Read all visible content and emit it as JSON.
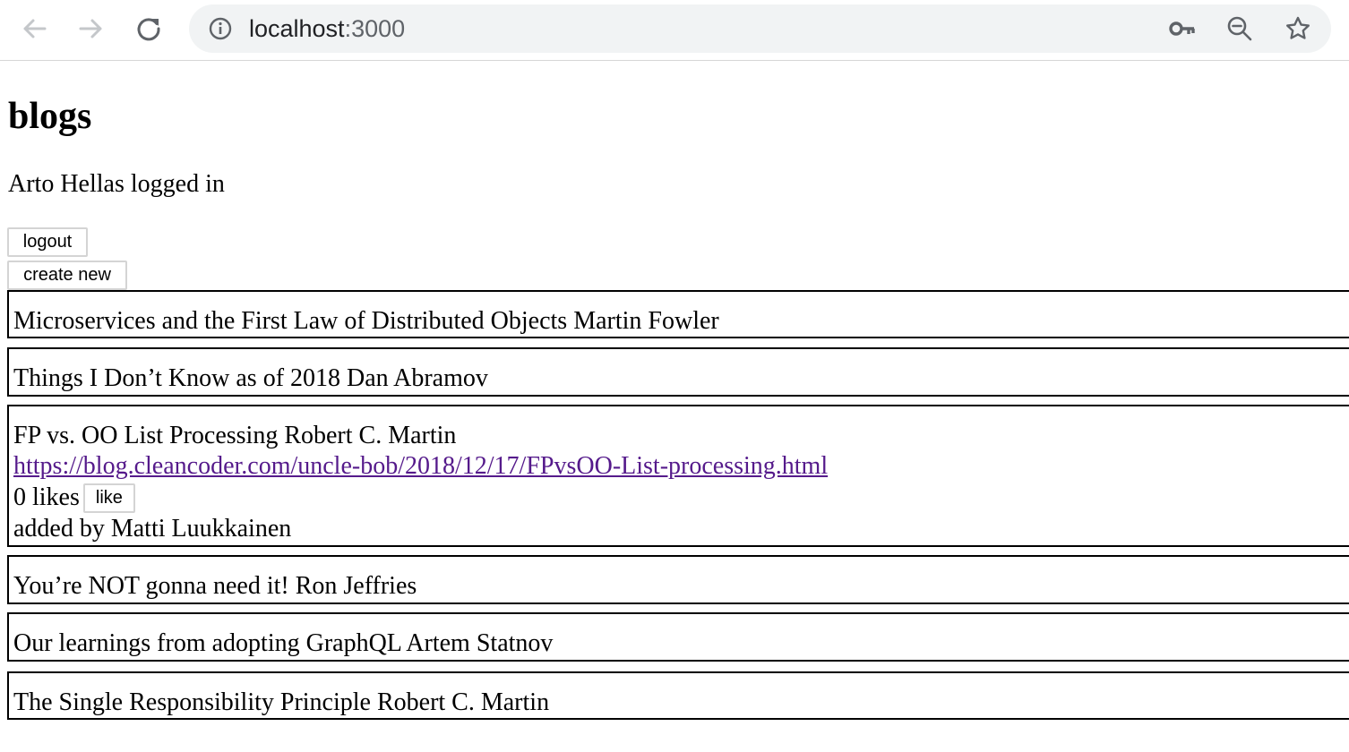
{
  "browser": {
    "url_host": "localhost",
    "url_port": ":3000"
  },
  "page": {
    "title": "blogs",
    "login_status": "Arto Hellas logged in",
    "logout_label": "logout",
    "create_label": "create new"
  },
  "blogs": [
    {
      "summary": "Microservices and the First Law of Distributed Objects Martin Fowler"
    },
    {
      "summary": "Things I Don’t Know as of 2018 Dan Abramov"
    },
    {
      "summary": "FP vs. OO List Processing Robert C. Martin",
      "url": "https://blog.cleancoder.com/uncle-bob/2018/12/17/FPvsOO-List-processing.html",
      "likes": "0 likes",
      "like_label": "like",
      "added_by": "added by Matti Luukkainen"
    },
    {
      "summary": "You’re NOT gonna need it! Ron Jeffries"
    },
    {
      "summary": "Our learnings from adopting GraphQL Artem Statnov"
    },
    {
      "summary": "The Single Responsibility Principle Robert C. Martin"
    }
  ],
  "colors": {
    "link": "#551a8b",
    "omnibox_bg": "#f1f3f4",
    "icon": "#5f6368"
  }
}
